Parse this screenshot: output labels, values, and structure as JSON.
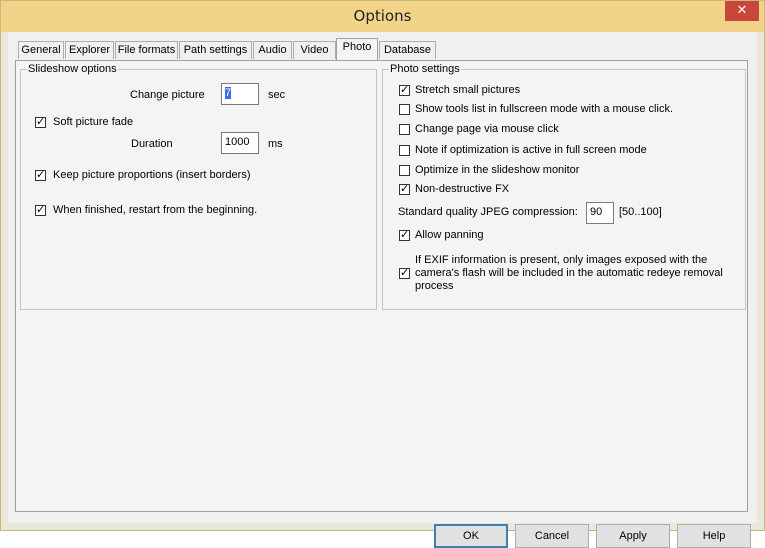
{
  "window": {
    "title": "Options",
    "close_symbol": "✕"
  },
  "tabs": [
    {
      "label": "General"
    },
    {
      "label": "Explorer"
    },
    {
      "label": "File formats"
    },
    {
      "label": "Path settings"
    },
    {
      "label": "Audio"
    },
    {
      "label": "Video"
    },
    {
      "label": "Photo",
      "active": true
    },
    {
      "label": "Database"
    }
  ],
  "slideshow": {
    "title": "Slideshow options",
    "change_picture_label": "Change picture",
    "change_picture_value": "7",
    "change_picture_unit": "sec",
    "soft_fade_label": "Soft picture fade",
    "soft_fade_checked": true,
    "duration_label": "Duration",
    "duration_value": "1000",
    "duration_unit": "ms",
    "keep_proportions_label": "Keep picture proportions (insert borders)",
    "keep_proportions_checked": true,
    "restart_label": "When finished, restart from the beginning.",
    "restart_checked": true
  },
  "photo": {
    "title": "Photo settings",
    "options": [
      {
        "label": "Stretch small pictures",
        "checked": true
      },
      {
        "label": "Show tools list in fullscreen mode with a mouse click.",
        "checked": false
      },
      {
        "label": "Change page via mouse click",
        "checked": false
      },
      {
        "label": "Note if optimization is active in full screen mode",
        "checked": false
      },
      {
        "label": "Optimize in the slideshow monitor",
        "checked": false
      },
      {
        "label": "Non-destructive FX",
        "checked": true
      }
    ],
    "jpeg_label": "Standard quality JPEG compression:",
    "jpeg_value": "90",
    "jpeg_range": "[50..100]",
    "allow_panning_label": "Allow panning",
    "allow_panning_checked": true,
    "exif_label_1": "If EXIF information is present, only images exposed with the",
    "exif_label_2": "camera's flash will be included in the automatic redeye removal",
    "exif_label_3": "process",
    "exif_checked": true
  },
  "buttons": {
    "ok": "OK",
    "cancel": "Cancel",
    "apply": "Apply",
    "help": "Help"
  },
  "colors": {
    "titlebar": "#f1d48a",
    "close": "#c7473b",
    "dialog": "#f0f0f0"
  }
}
